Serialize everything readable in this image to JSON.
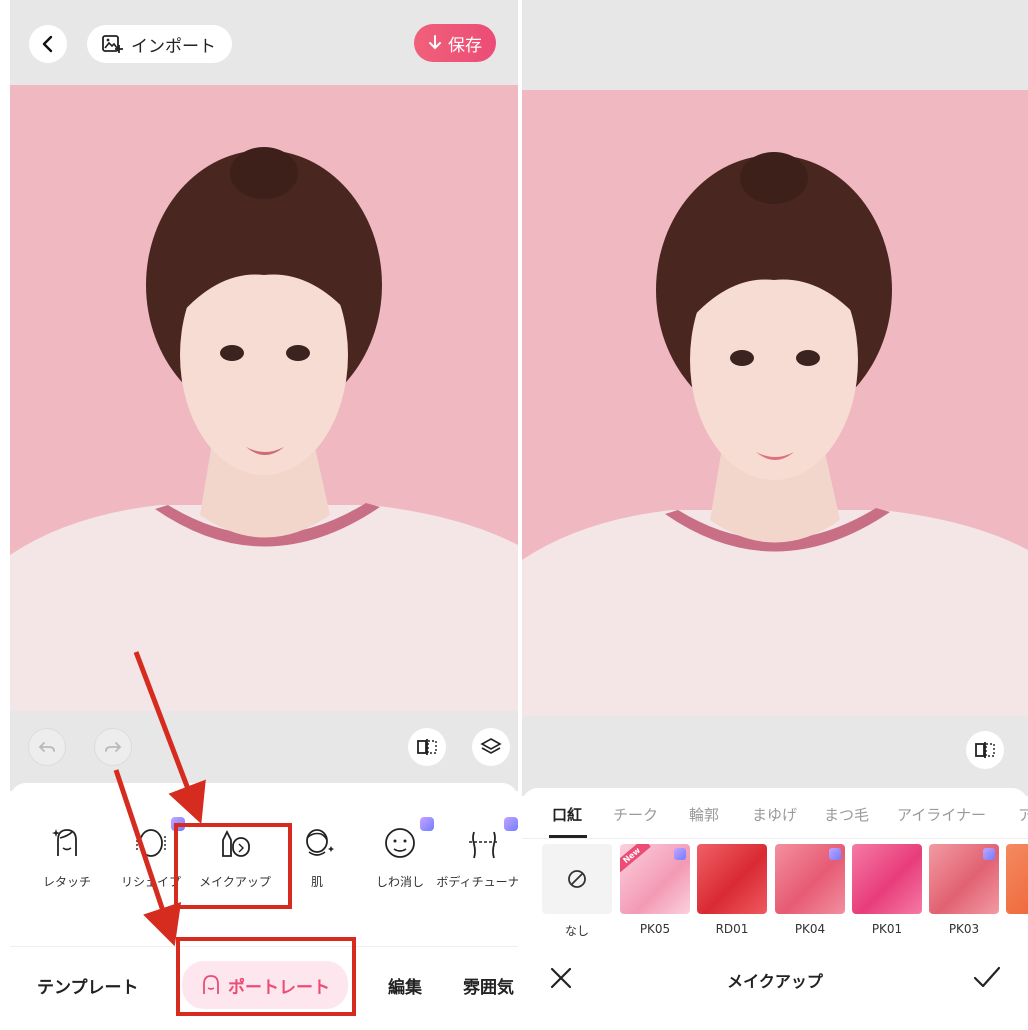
{
  "left": {
    "topbar": {
      "import_label": "インポート",
      "save_label": "保存"
    },
    "tools": [
      {
        "label": "レタッチ",
        "icon": "retouch-face-icon",
        "premium": false
      },
      {
        "label": "リシェイプ",
        "icon": "reshape-face-icon",
        "premium": true
      },
      {
        "label": "メイクアップ",
        "icon": "makeup-icon",
        "premium": false
      },
      {
        "label": "肌",
        "icon": "skin-icon",
        "premium": false
      },
      {
        "label": "しわ消し",
        "icon": "wrinkle-face-icon",
        "premium": true
      },
      {
        "label": "ボディチューナー",
        "icon": "body-tuner-icon",
        "premium": true
      }
    ],
    "bottom_tabs": {
      "template": "テンプレート",
      "portrait": "ポートレート",
      "edit": "編集",
      "atmosphere": "雰囲気"
    }
  },
  "right": {
    "categories": [
      "口紅",
      "チーク",
      "輪郭",
      "まゆげ",
      "まつ毛",
      "アイライナー",
      "ア"
    ],
    "active_category": "口紅",
    "swatches": [
      {
        "label": "なし",
        "color": "#f3f3f3",
        "none": true
      },
      {
        "label": "PK05",
        "color": "#f6a7c0",
        "new": true,
        "premium": true
      },
      {
        "label": "RD01",
        "color": "#e2363d"
      },
      {
        "label": "PK04",
        "color": "#ec6a82",
        "premium": true
      },
      {
        "label": "PK01",
        "color": "#ee4f86"
      },
      {
        "label": "PK03",
        "color": "#e8707d",
        "premium": true
      },
      {
        "label": "",
        "color": "#f06a3f"
      }
    ],
    "new_badge": "New",
    "footer_title": "メイクアップ"
  },
  "colors": {
    "accent": "#ec4c76",
    "annotation": "#d62c1f",
    "background_pink": "#f0b8c0"
  }
}
